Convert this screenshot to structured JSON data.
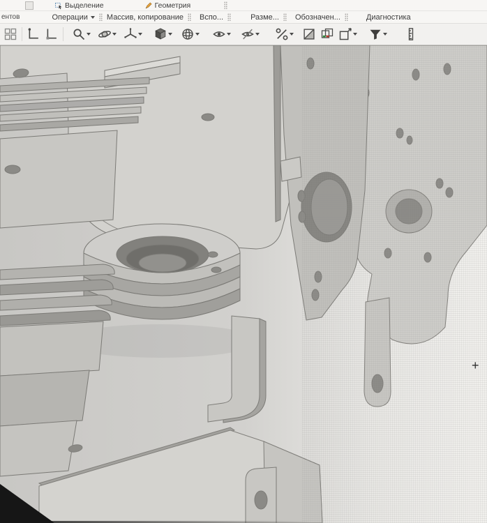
{
  "ribbon": {
    "left_panel_fragment": "ентов",
    "row1_items": [
      {
        "label": "Выделение",
        "icon": "selection-icon"
      },
      {
        "label": "Геометрия",
        "icon": "pencil-icon"
      }
    ],
    "group_titles": [
      {
        "label": "Операции",
        "dropdown": true
      },
      {
        "label": "Массив, копирование",
        "dropdown": false
      },
      {
        "label": "Вспо...",
        "dropdown": false
      },
      {
        "label": "Разме...",
        "dropdown": false
      },
      {
        "label": "Обозначен...",
        "dropdown": false
      },
      {
        "label": "Диагностика",
        "dropdown": false
      }
    ]
  },
  "toolbar": {
    "buttons": [
      {
        "name": "panel-grid",
        "dropdown": false
      },
      {
        "name": "local-csys-1",
        "dropdown": false
      },
      {
        "name": "local-csys-2",
        "dropdown": false
      },
      {
        "name": "zoom",
        "dropdown": true
      },
      {
        "name": "orbit-rotate",
        "dropdown": true
      },
      {
        "name": "coordinate-axes",
        "dropdown": true
      },
      {
        "name": "orientation-cube",
        "dropdown": true
      },
      {
        "name": "display-wireframe",
        "dropdown": true
      },
      {
        "name": "show-hide",
        "dropdown": true
      },
      {
        "name": "hide-in-components",
        "dropdown": true
      },
      {
        "name": "snaps",
        "dropdown": true
      },
      {
        "name": "section-view",
        "dropdown": false
      },
      {
        "name": "zones",
        "dropdown": false
      },
      {
        "name": "clip-box",
        "dropdown": true
      },
      {
        "name": "filter",
        "dropdown": true
      },
      {
        "name": "measure-ruler",
        "dropdown": false
      }
    ]
  },
  "canvas": {
    "cursor_glyph": "+"
  },
  "colors": {
    "toolbar_bg": "#f2f1ef",
    "canvas_bg_left": "#c8c7c4",
    "canvas_bg_right": "#f1f0ed",
    "model_gray": "#cfcecb",
    "model_edge": "#7b7a76",
    "hole_gray": "#8b8a86",
    "funnel_dark": "#3f3e3c",
    "zone_green": "#2e8b3a",
    "zone_red": "#c0392b",
    "bezel_black": "#161616"
  }
}
